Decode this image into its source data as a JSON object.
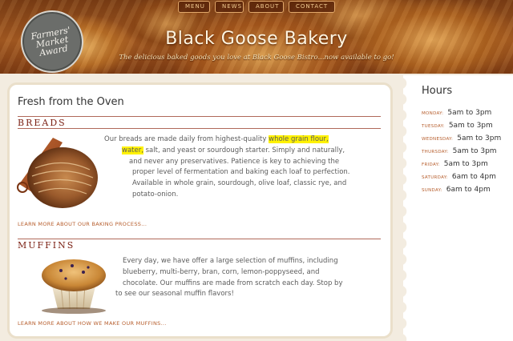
{
  "nav": {
    "items": [
      {
        "label": "MENU"
      },
      {
        "label": "NEWS"
      },
      {
        "label": "ABOUT"
      },
      {
        "label": "CONTACT"
      }
    ]
  },
  "badge": {
    "line1": "Farmers'",
    "line2": "Market",
    "line3": "Award"
  },
  "header": {
    "title": "Black Goose Bakery",
    "tagline": "The delicious baked goods you love at Black Goose Bistro...now available to go!"
  },
  "main": {
    "heading": "Fresh from the Oven",
    "breads": {
      "title": "BREADS",
      "lines": [
        {
          "before": "Our breads are made daily from highest-quality ",
          "highlight": "whole grain flour,",
          "after": ""
        },
        {
          "before": "",
          "highlight": "water,",
          "after": " salt, and yeast or sourdough starter. Simply and naturally,"
        },
        {
          "before": "and never any preservatives. Patience is key to achieving the",
          "highlight": "",
          "after": ""
        },
        {
          "before": "proper level of fermentation and baking each loaf to perfection.",
          "highlight": "",
          "after": ""
        },
        {
          "before": "Available in whole grain, sourdough, olive loaf, classic rye, and",
          "highlight": "",
          "after": ""
        },
        {
          "before": "potato-onion.",
          "highlight": "",
          "after": ""
        }
      ],
      "learn_more": "LEARN MORE ABOUT OUR BAKING PROCESS..."
    },
    "muffins": {
      "title": "MUFFINS",
      "lines": [
        "Every day, we have offer a large selection of muffins, including",
        "blueberry, multi-berry, bran, corn, lemon-poppyseed, and",
        "chocolate. Our muffins are made from scratch each day. Stop by",
        "to see our seasonal muffin flavors!"
      ],
      "learn_more": "LEARN MORE ABOUT HOW WE MAKE OUR MUFFINS..."
    }
  },
  "sidebar": {
    "title": "Hours",
    "rows": [
      {
        "day": "MONDAY:",
        "time": "5am to 3pm"
      },
      {
        "day": "TUESDAY:",
        "time": "5am to 3pm"
      },
      {
        "day": "WEDNESDAY:",
        "time": "5am to 3pm"
      },
      {
        "day": "THURSDAY:",
        "time": "5am to 3pm"
      },
      {
        "day": "FRIDAY:",
        "time": "5am to 3pm"
      },
      {
        "day": "SATURDAY:",
        "time": "6am to 4pm"
      },
      {
        "day": "SUNDAY:",
        "time": "6am to 4pm"
      }
    ]
  },
  "colors": {
    "accent": "#7a1f12",
    "link": "#b65d2c",
    "highlight": "#fff200",
    "background": "#f3ece0"
  }
}
